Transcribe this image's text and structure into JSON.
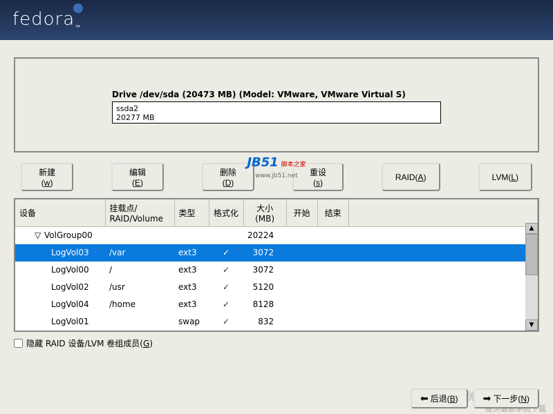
{
  "logo": "fedora",
  "drive": {
    "title": "Drive /dev/sda (20473 MB) (Model: VMware, VMware Virtual S)",
    "partition": "ssda2",
    "size": "20277 MB"
  },
  "watermark": {
    "brand": "JB51",
    "cn": "脚本之家",
    "url": "www.jb51.net"
  },
  "toolbar": {
    "new": "新建(w)",
    "edit": "编辑(E)",
    "delete": "删除(D)",
    "reset": "重设(s)",
    "raid": "RAID(A)",
    "lvm": "LVM(L)"
  },
  "columns": {
    "device": "设备",
    "mount": "挂载点/\nRAID/Volume",
    "type": "类型",
    "format": "格式化",
    "size": "大小\n(MB)",
    "start": "开始",
    "end": "结束"
  },
  "rows": [
    {
      "device": "VolGroup00",
      "mount": "",
      "type": "",
      "format": false,
      "size": "20224",
      "indent": 1,
      "toggle": true
    },
    {
      "device": "LogVol03",
      "mount": "/var",
      "type": "ext3",
      "format": true,
      "size": "3072",
      "indent": 2,
      "selected": true
    },
    {
      "device": "LogVol00",
      "mount": "/",
      "type": "ext3",
      "format": true,
      "size": "3072",
      "indent": 2
    },
    {
      "device": "LogVol02",
      "mount": "/usr",
      "type": "ext3",
      "format": true,
      "size": "5120",
      "indent": 2
    },
    {
      "device": "LogVol04",
      "mount": "/home",
      "type": "ext3",
      "format": true,
      "size": "8128",
      "indent": 2
    },
    {
      "device": "LogVol01",
      "mount": "",
      "type": "swap",
      "format": true,
      "size": "832",
      "indent": 2
    }
  ],
  "hide_checkbox": "隐藏 RAID 设备/LVM 卷组成员(G)",
  "footer": {
    "back": "后退(B)",
    "next_partial": "(N)"
  },
  "footer_wm": "系 统 之 家",
  "footer_wm2": "提供最新系统下载"
}
